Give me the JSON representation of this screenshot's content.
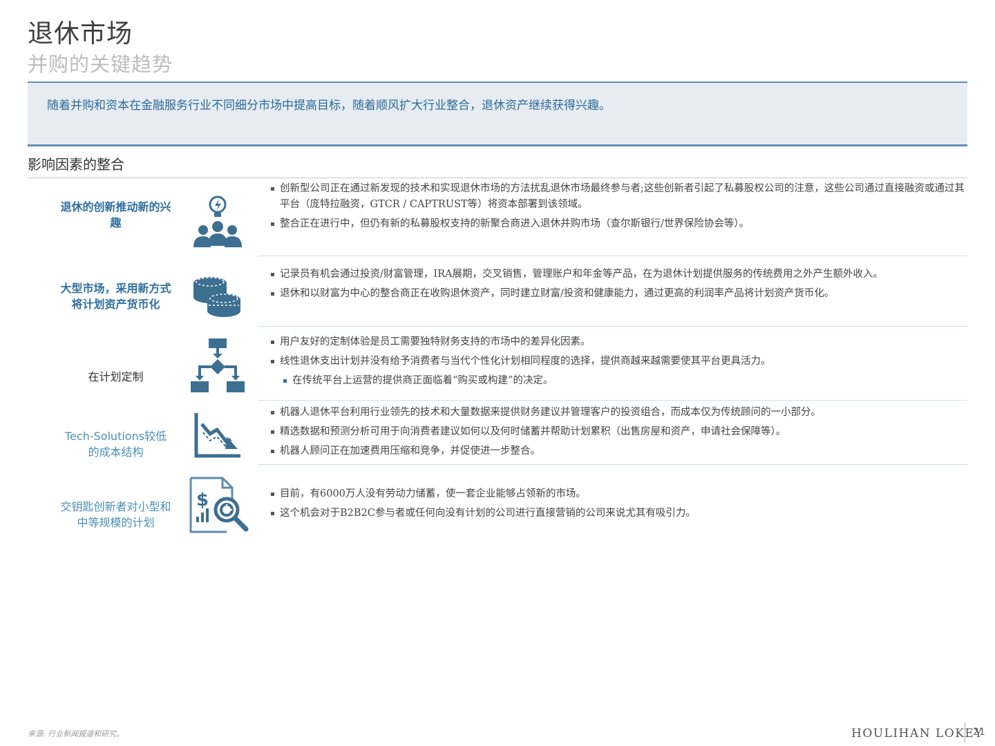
{
  "header": {
    "title": "退休市场",
    "subtitle": "并购的关键趋势"
  },
  "callout": {
    "text": "随着并购和资本在金融服务行业不同细分市场中提高目标，随着顺风扩大行业整合，退休资产继续获得兴趣。"
  },
  "section": {
    "heading": "影响因素的整合"
  },
  "rows": [
    {
      "label_line1": "退休的创新推动新的兴",
      "label_line2": "趣",
      "icon": "lightbulb-people-icon",
      "bullets": [
        "创新型公司正在通过新发现的技术和实现退休市场的方法扰乱退休市场最终参与者;这些创新者引起了私募股权公司的注意，这些公司通过直接融资或通过其平台（庞特拉融资，GTCR / CAPTRUST等）将资本部署到该领域。",
        "整合正在进行中，但仍有新的私募股权支持的新聚合商进入退休并购市场（查尔斯银行/世界保险协会等）。"
      ]
    },
    {
      "label_line1": "大型市场，采用新方式",
      "label_line2": "将计划资产货币化",
      "icon": "coin-stacks-icon",
      "bullets": [
        "记录员有机会通过投资/财富管理，IRA展期，交叉销售，管理账户和年金等产品，在为退休计划提供服务的传统费用之外产生额外收入。",
        "退休和以财富为中心的整合商正在收购退休资产，同时建立财富/投资和健康能力，通过更高的利润率产品将计划资产货币化。"
      ]
    },
    {
      "label_line1": "在计划定制",
      "label_line2": "",
      "icon": "decision-flowchart-icon",
      "bullets": [
        "用户友好的定制体验是员工需要独特财务支持的市场中的差异化因素。",
        "线性退休支出计划并没有给予消费者与当代个性化计划相同程度的选择，提供商越来越需要使其平台更具活力。"
      ],
      "sub_bullets": [
        "在传统平台上运营的提供商正面临着“购买或构建”的决定。"
      ]
    },
    {
      "label_line1": "Tech-Solutions较低",
      "label_line2": "的成本结构",
      "icon": "declining-chart-icon",
      "bullets": [
        "机器人退休平台利用行业领先的技术和大量数据来提供财务建议并管理客户的投资组合，而成本仅为传统顾问的一小部分。",
        "精选数据和预测分析可用于向消费者建议如何以及何时储蓄并帮助计划累积（出售房屋和资产，申请社会保障等）。",
        "机器人顾问正在加速费用压缩和竞争，并促使进一步整合。"
      ]
    },
    {
      "label_line1": "交钥匙创新者对小型和",
      "label_line2": "中等规模的计划",
      "icon": "financial-report-search-icon",
      "bullets": [
        "目前，有6000万人没有劳动力储蓄，使一套企业能够占领新的市场。",
        "这个机会对于B2B2C参与者或任何向没有计划的公司进行直接营销的公司来说尤其有吸引力。"
      ]
    }
  ],
  "footer": {
    "source": "来源: 行业新闻报道和研究。",
    "brand": "HOULIHAN LOKEY",
    "page_number": "21"
  },
  "colors": {
    "accent": "#2e6f9e",
    "icon": "#3d6f91",
    "callout_bg": "#e6ecf1",
    "callout_border": "#5f8fb4"
  }
}
